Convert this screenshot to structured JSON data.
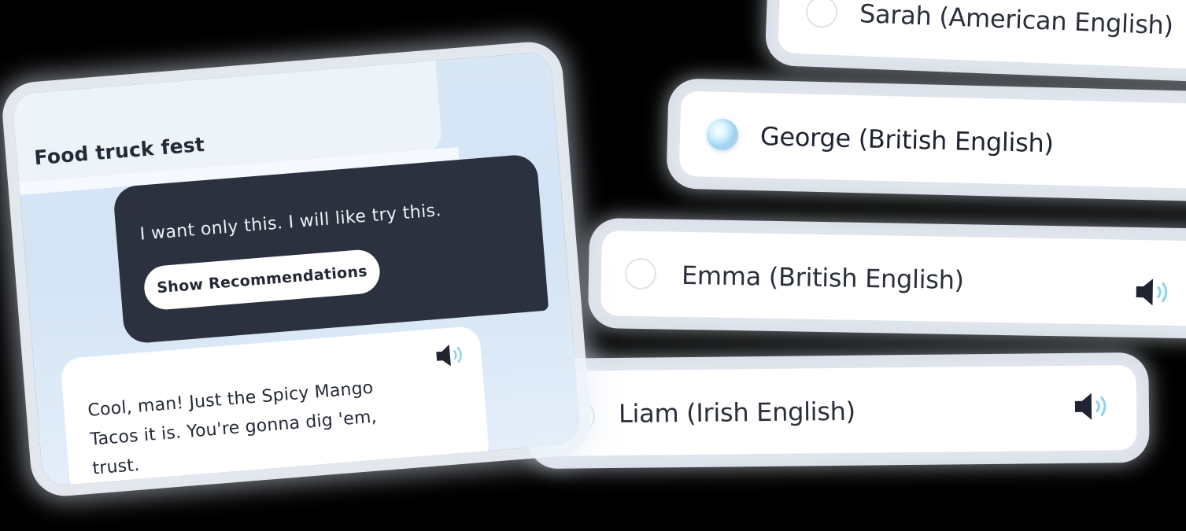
{
  "chat": {
    "title": "Food truck fest",
    "user_message": "I want only this. I will like try this.",
    "recommendations_button": "Show Recommendations",
    "bot_message": "Cool, man! Just the Spicy Mango Tacos it is. You're gonna dig 'em, trust.",
    "bot_speaker_icon": "speaker-icon"
  },
  "voices": [
    {
      "label": "Sarah (American English)",
      "selected": false,
      "has_speaker": false
    },
    {
      "label": "George (British English)",
      "selected": true,
      "has_speaker": false
    },
    {
      "label": "Emma (British English)",
      "selected": false,
      "has_speaker": true
    },
    {
      "label": "Liam (Irish English)",
      "selected": false,
      "has_speaker": true
    }
  ],
  "colors": {
    "page_background": "#000000",
    "user_bubble": "#2c313f",
    "panel_background": "#d8e7f6",
    "card_background": "#ffffff",
    "text_dark": "#232935",
    "speaker_wave": "#8fd0ee"
  }
}
